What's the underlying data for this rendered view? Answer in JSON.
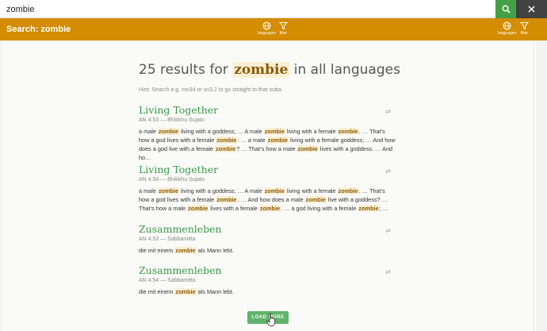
{
  "search": {
    "value": "zombie"
  },
  "toolbar": {
    "title": "Search: zombie",
    "center_tools": [
      {
        "label": "languages",
        "icon": "globe-icon"
      },
      {
        "label": "filter",
        "icon": "filter-icon"
      }
    ],
    "right_tools": [
      {
        "label": "languages",
        "icon": "globe-icon"
      },
      {
        "label": "filter",
        "icon": "filter-icon"
      }
    ]
  },
  "header": {
    "count_prefix": "25 results for",
    "keyword": "zombie",
    "count_suffix": "in all languages",
    "hint": "Hint: Search e.g. mn34 or sn3.2 to go straight to that sutta."
  },
  "results": [
    {
      "title": "Living Together",
      "meta": "AN 4.53 — Bhikkhu Sujato",
      "snippet": [
        "a male ",
        {
          "hl": "zombie"
        },
        " living with a goddess; … A male ",
        {
          "hl": "zombie"
        },
        " living with a female ",
        {
          "hl": "zombie"
        },
        ". … That’s how a god lives with a female ",
        {
          "hl": "zombie"
        },
        ". … a male ",
        {
          "hl": "zombie"
        },
        " living with a female goddess; … And how does a god live with a female ",
        {
          "hl": "zombie"
        },
        "? … That’s how a male ",
        {
          "hl": "zombie"
        },
        " lives with a goddess. … And ho…"
      ]
    },
    {
      "title": "Living Together",
      "meta": "AN 4.54 — Bhikkhu Sujato",
      "snippet": [
        "a male ",
        {
          "hl": "zombie"
        },
        " living with a goddess; … A male ",
        {
          "hl": "zombie"
        },
        " living with a female ",
        {
          "hl": "zombie"
        },
        ". … That’s how a god lives with a female ",
        {
          "hl": "zombie"
        },
        ". … And how does a male ",
        {
          "hl": "zombie"
        },
        " live with a goddess? … That’s how a male ",
        {
          "hl": "zombie"
        },
        " lives with a female ",
        {
          "hl": "zombie"
        },
        ". … a god living with a female ",
        {
          "hl": "zombie"
        },
        "; …"
      ]
    },
    {
      "title": "Zusammenleben",
      "meta": "AN 4.53 — Sabbamitta",
      "snippet": [
        "die mit einem ",
        {
          "hl": "zombie"
        },
        " als Mann lebt."
      ]
    },
    {
      "title": "Zusammenleben",
      "meta": "AN 4.54 — Sabbamitta",
      "snippet": [
        "die mit einem ",
        {
          "hl": "zombie"
        },
        " als Mann lebt."
      ]
    }
  ],
  "load_more": {
    "label": "LOAD MORE"
  },
  "colors": {
    "accent": "#d48c00",
    "link_green": "#3a9a4a",
    "highlight_bg": "#fbefd6",
    "button_green": "#5fb36b"
  }
}
